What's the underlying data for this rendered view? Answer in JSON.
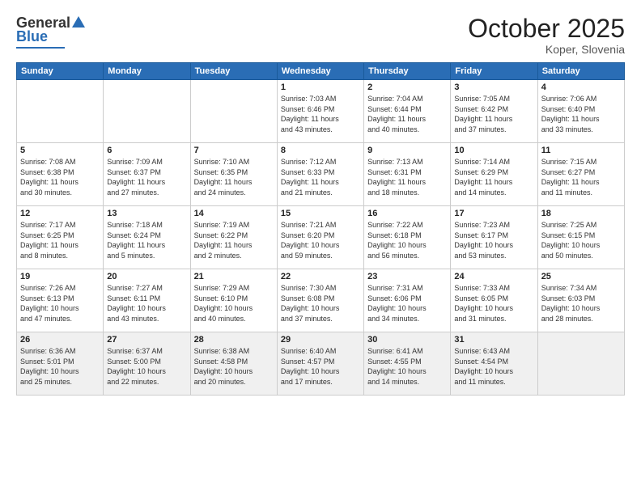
{
  "logo": {
    "general": "General",
    "blue": "Blue"
  },
  "header": {
    "month": "October 2025",
    "location": "Koper, Slovenia"
  },
  "weekdays": [
    "Sunday",
    "Monday",
    "Tuesday",
    "Wednesday",
    "Thursday",
    "Friday",
    "Saturday"
  ],
  "weeks": [
    [
      {
        "day": "",
        "info": ""
      },
      {
        "day": "",
        "info": ""
      },
      {
        "day": "",
        "info": ""
      },
      {
        "day": "1",
        "info": "Sunrise: 7:03 AM\nSunset: 6:46 PM\nDaylight: 11 hours\nand 43 minutes."
      },
      {
        "day": "2",
        "info": "Sunrise: 7:04 AM\nSunset: 6:44 PM\nDaylight: 11 hours\nand 40 minutes."
      },
      {
        "day": "3",
        "info": "Sunrise: 7:05 AM\nSunset: 6:42 PM\nDaylight: 11 hours\nand 37 minutes."
      },
      {
        "day": "4",
        "info": "Sunrise: 7:06 AM\nSunset: 6:40 PM\nDaylight: 11 hours\nand 33 minutes."
      }
    ],
    [
      {
        "day": "5",
        "info": "Sunrise: 7:08 AM\nSunset: 6:38 PM\nDaylight: 11 hours\nand 30 minutes."
      },
      {
        "day": "6",
        "info": "Sunrise: 7:09 AM\nSunset: 6:37 PM\nDaylight: 11 hours\nand 27 minutes."
      },
      {
        "day": "7",
        "info": "Sunrise: 7:10 AM\nSunset: 6:35 PM\nDaylight: 11 hours\nand 24 minutes."
      },
      {
        "day": "8",
        "info": "Sunrise: 7:12 AM\nSunset: 6:33 PM\nDaylight: 11 hours\nand 21 minutes."
      },
      {
        "day": "9",
        "info": "Sunrise: 7:13 AM\nSunset: 6:31 PM\nDaylight: 11 hours\nand 18 minutes."
      },
      {
        "day": "10",
        "info": "Sunrise: 7:14 AM\nSunset: 6:29 PM\nDaylight: 11 hours\nand 14 minutes."
      },
      {
        "day": "11",
        "info": "Sunrise: 7:15 AM\nSunset: 6:27 PM\nDaylight: 11 hours\nand 11 minutes."
      }
    ],
    [
      {
        "day": "12",
        "info": "Sunrise: 7:17 AM\nSunset: 6:25 PM\nDaylight: 11 hours\nand 8 minutes."
      },
      {
        "day": "13",
        "info": "Sunrise: 7:18 AM\nSunset: 6:24 PM\nDaylight: 11 hours\nand 5 minutes."
      },
      {
        "day": "14",
        "info": "Sunrise: 7:19 AM\nSunset: 6:22 PM\nDaylight: 11 hours\nand 2 minutes."
      },
      {
        "day": "15",
        "info": "Sunrise: 7:21 AM\nSunset: 6:20 PM\nDaylight: 10 hours\nand 59 minutes."
      },
      {
        "day": "16",
        "info": "Sunrise: 7:22 AM\nSunset: 6:18 PM\nDaylight: 10 hours\nand 56 minutes."
      },
      {
        "day": "17",
        "info": "Sunrise: 7:23 AM\nSunset: 6:17 PM\nDaylight: 10 hours\nand 53 minutes."
      },
      {
        "day": "18",
        "info": "Sunrise: 7:25 AM\nSunset: 6:15 PM\nDaylight: 10 hours\nand 50 minutes."
      }
    ],
    [
      {
        "day": "19",
        "info": "Sunrise: 7:26 AM\nSunset: 6:13 PM\nDaylight: 10 hours\nand 47 minutes."
      },
      {
        "day": "20",
        "info": "Sunrise: 7:27 AM\nSunset: 6:11 PM\nDaylight: 10 hours\nand 43 minutes."
      },
      {
        "day": "21",
        "info": "Sunrise: 7:29 AM\nSunset: 6:10 PM\nDaylight: 10 hours\nand 40 minutes."
      },
      {
        "day": "22",
        "info": "Sunrise: 7:30 AM\nSunset: 6:08 PM\nDaylight: 10 hours\nand 37 minutes."
      },
      {
        "day": "23",
        "info": "Sunrise: 7:31 AM\nSunset: 6:06 PM\nDaylight: 10 hours\nand 34 minutes."
      },
      {
        "day": "24",
        "info": "Sunrise: 7:33 AM\nSunset: 6:05 PM\nDaylight: 10 hours\nand 31 minutes."
      },
      {
        "day": "25",
        "info": "Sunrise: 7:34 AM\nSunset: 6:03 PM\nDaylight: 10 hours\nand 28 minutes."
      }
    ],
    [
      {
        "day": "26",
        "info": "Sunrise: 6:36 AM\nSunset: 5:01 PM\nDaylight: 10 hours\nand 25 minutes."
      },
      {
        "day": "27",
        "info": "Sunrise: 6:37 AM\nSunset: 5:00 PM\nDaylight: 10 hours\nand 22 minutes."
      },
      {
        "day": "28",
        "info": "Sunrise: 6:38 AM\nSunset: 4:58 PM\nDaylight: 10 hours\nand 20 minutes."
      },
      {
        "day": "29",
        "info": "Sunrise: 6:40 AM\nSunset: 4:57 PM\nDaylight: 10 hours\nand 17 minutes."
      },
      {
        "day": "30",
        "info": "Sunrise: 6:41 AM\nSunset: 4:55 PM\nDaylight: 10 hours\nand 14 minutes."
      },
      {
        "day": "31",
        "info": "Sunrise: 6:43 AM\nSunset: 4:54 PM\nDaylight: 10 hours\nand 11 minutes."
      },
      {
        "day": "",
        "info": ""
      }
    ]
  ]
}
